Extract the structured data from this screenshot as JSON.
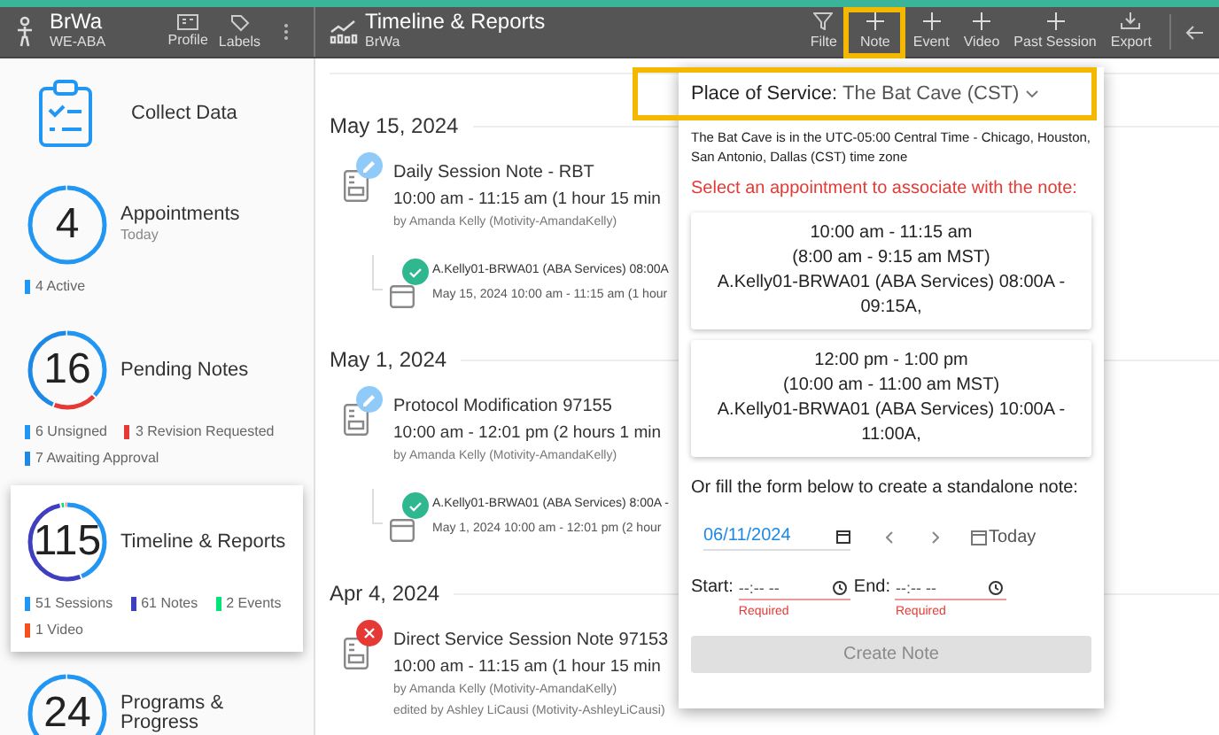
{
  "header": {
    "patient_name": "BrWa",
    "patient_org": "WE-ABA",
    "actions": [
      {
        "label": "Profile",
        "kind": "profile"
      },
      {
        "label": "Labels",
        "kind": "labels"
      }
    ],
    "section_title": "Timeline & Reports",
    "section_subtitle": "BrWa",
    "toolbar": [
      {
        "label": "Filte",
        "kind": "filter",
        "highlighted": false
      },
      {
        "label": "Note",
        "kind": "add",
        "highlighted": true
      },
      {
        "label": "Event",
        "kind": "add",
        "highlighted": false
      },
      {
        "label": "Video",
        "kind": "add",
        "highlighted": false
      },
      {
        "label": "Past Session",
        "kind": "add",
        "highlighted": false
      },
      {
        "label": "Export",
        "kind": "export",
        "highlighted": false
      }
    ]
  },
  "sidebar": {
    "collect_data": "Collect Data",
    "cards": [
      {
        "count": "4",
        "title": "Appointments",
        "subtitle": "Today",
        "selected": false,
        "legend": [
          {
            "label": "4 Active",
            "color": "#2196f3"
          }
        ]
      },
      {
        "count": "16",
        "title": "Pending Notes",
        "selected": false,
        "legend": [
          {
            "label": "6 Unsigned",
            "color": "#2196f3"
          },
          {
            "label": "3 Revision Requested",
            "color": "#e53935"
          },
          {
            "label": "7 Awaiting Approval",
            "color": "#1e88e5"
          }
        ]
      },
      {
        "count": "115",
        "title": "Timeline & Reports",
        "selected": true,
        "legend": [
          {
            "label": "51 Sessions",
            "color": "#2196f3"
          },
          {
            "label": "61 Notes",
            "color": "#3f3fbf"
          },
          {
            "label": "2 Events",
            "color": "#00e676"
          },
          {
            "label": "1 Video",
            "color": "#f4511e"
          }
        ]
      },
      {
        "count": "24",
        "title": "Programs & Progress",
        "selected": false
      }
    ]
  },
  "timeline": [
    {
      "date": "May 15, 2024",
      "entries": [
        {
          "kind": "draft",
          "title": "Daily Session Note - RBT",
          "time": "10:00 am - 11:15 am (1 hour 15 min",
          "by": "by Amanda Kelly (Motivity-AmandaKelly)",
          "linked": {
            "kind": "done",
            "title": "A.Kelly01-BRWA01 (ABA Services) 08:00A",
            "time": "May 15, 2024 10:00 am - 11:15 am (1 hour"
          }
        }
      ]
    },
    {
      "date": "May 1, 2024",
      "entries": [
        {
          "kind": "draft",
          "title": "Protocol Modification 97155",
          "time": "10:00 am - 12:01 pm (2 hours 1 min",
          "by": "by Amanda Kelly (Motivity-AmandaKelly)",
          "linked": {
            "kind": "done",
            "title": "A.Kelly01-BRWA01 (ABA Services) 8:00A -",
            "time": "May 1, 2024 10:00 am - 12:01 pm (2 hour"
          }
        }
      ]
    },
    {
      "date": "Apr 4, 2024",
      "entries": [
        {
          "kind": "rejected",
          "title": "Direct Service Session Note 97153",
          "time": "10:00 am - 11:15 am (1 hour 15 min",
          "by": "by Amanda Kelly (Motivity-AmandaKelly)",
          "edited": "edited by Ashley LiCausi (Motivity-AshleyLiCausi)"
        }
      ]
    }
  ],
  "note_popup": {
    "place_label": "Place of Service:",
    "place_value": "The Bat Cave (CST)",
    "place_highlighted": true,
    "timezone_note": "The Bat Cave is in the UTC-05:00 Central Time - Chicago, Houston, San Antonio, Dallas (CST) time zone",
    "prompt": "Select an appointment to associate with the note:",
    "appointments": [
      {
        "time": "10:00 am - 11:15 am",
        "local_time": "(8:00 am - 9:15 am MST)",
        "name": "A.Kelly01-BRWA01 (ABA Services) 08:00A - 09:15A,"
      },
      {
        "time": "12:00 pm - 1:00 pm",
        "local_time": "(10:00 am - 11:00 am MST)",
        "name": "A.Kelly01-BRWA01 (ABA Services) 10:00A - 11:00A,"
      }
    ],
    "standalone_prompt": "Or fill the form below to create a standalone note:",
    "date": "06/11/2024",
    "today": "Today",
    "start": {
      "label": "Start:",
      "placeholder": "--:-- --",
      "error": "Required"
    },
    "end": {
      "label": "End:",
      "placeholder": "--:-- --",
      "error": "Required"
    },
    "submit": {
      "label": "Create Note",
      "disabled": true
    }
  }
}
